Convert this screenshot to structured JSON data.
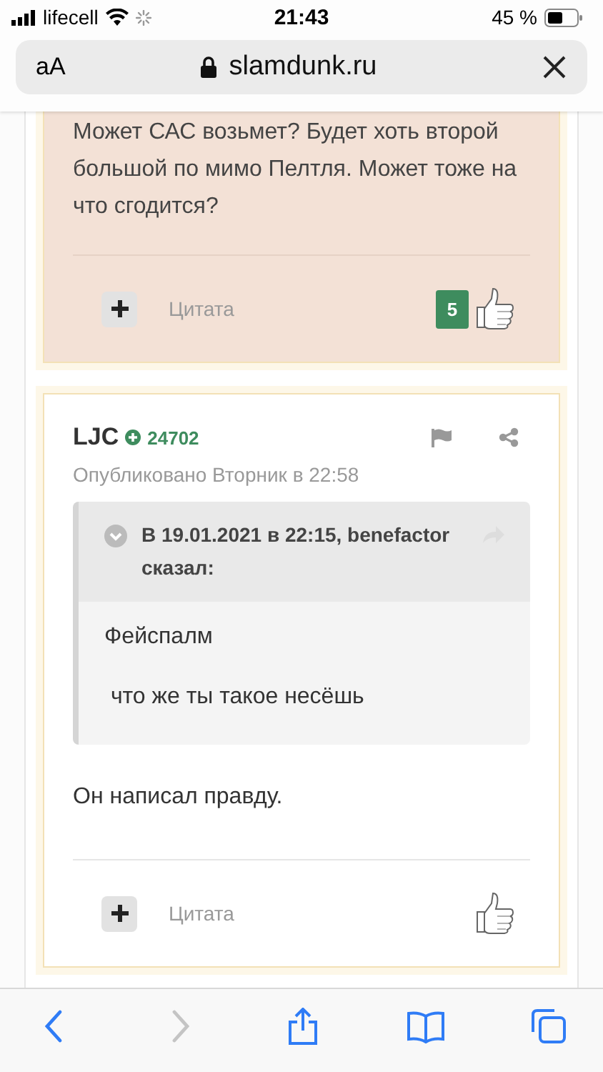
{
  "status_bar": {
    "carrier": "lifecell",
    "time": "21:43",
    "battery": "45 %"
  },
  "address_bar": {
    "text_size": "aA",
    "url": "slamdunk.ru"
  },
  "posts": [
    {
      "highlighted": true,
      "body": "Может САС возьмет? Будет хоть второй большой по мимо Пелтля. Может тоже на что сгодится?",
      "quote_label": "Цитата",
      "likes": "5"
    },
    {
      "highlighted": false,
      "author": "LJC",
      "reputation": "24702",
      "published": "Опубликовано Вторник в 22:58",
      "quote": {
        "header": "В 19.01.2021 в 22:15, benefactor сказал:",
        "lines": [
          "Фейспалм",
          " что же ты такое несёшь"
        ]
      },
      "body": "Он написал правду.",
      "quote_label": "Цитата"
    }
  ],
  "toolbar": [
    {
      "kind": "back",
      "disabled": false
    },
    {
      "kind": "forward",
      "disabled": true
    },
    {
      "kind": "share",
      "disabled": false
    },
    {
      "kind": "bookmarks",
      "disabled": false
    },
    {
      "kind": "tabs",
      "disabled": false
    }
  ]
}
